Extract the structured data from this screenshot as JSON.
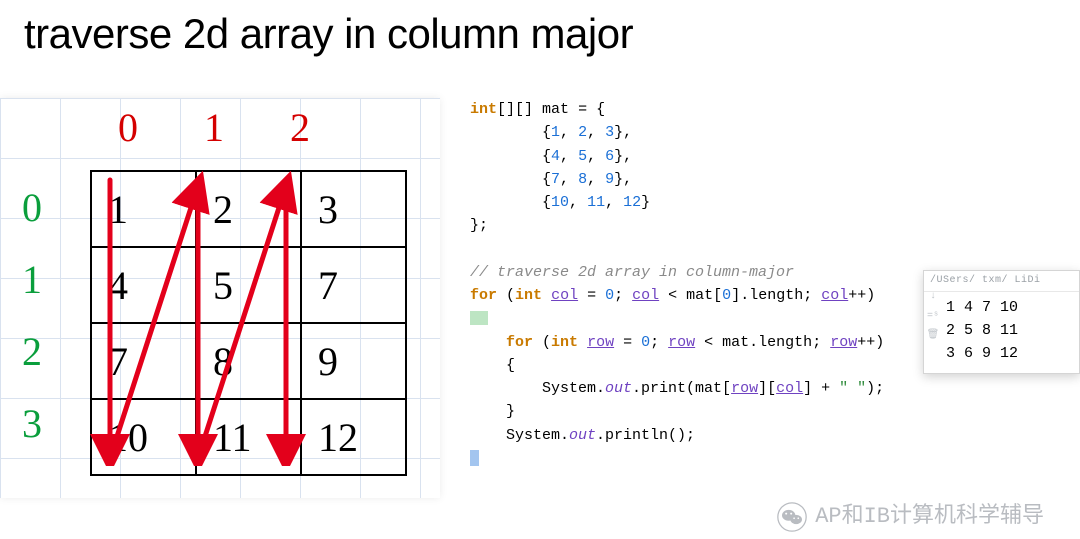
{
  "title": "traverse 2d array in column major",
  "diagram": {
    "col_labels": [
      "0",
      "1",
      "2"
    ],
    "row_labels": [
      "0",
      "1",
      "2",
      "3"
    ],
    "matrix": [
      [
        "1",
        "2",
        "3"
      ],
      [
        "4",
        "5",
        "7"
      ],
      [
        "7",
        "8",
        "9"
      ],
      [
        "10",
        "11",
        "12"
      ]
    ]
  },
  "code": {
    "decl_kw": "int",
    "decl_brackets": "[][]",
    "decl_var": "mat",
    "decl_eq": " = {",
    "rows": [
      "{1, 2, 3},",
      "{4, 5, 6},",
      "{7, 8, 9},",
      "{10, 11, 12}"
    ],
    "decl_close": "};",
    "comment": "// traverse 2d array in column-major",
    "for_outer_kw": "for",
    "for_outer_open": " (",
    "for_outer_int": "int",
    "for_outer_var": "col",
    "for_outer_init": " = ",
    "zero": "0",
    "semi": "; ",
    "lt": " < ",
    "mat0len": "mat[0].length",
    "matlen": "mat.length",
    "pp": "++",
    "for_inner_var": "row",
    "brace_open": "{",
    "brace_close": "}",
    "print_lead": "System.",
    "print_out": "out",
    "print_call": ".print(mat[",
    "print_mid": "][",
    "print_tail": "] + ",
    "print_space_str": "\" \"",
    "print_end": ");",
    "println_call": ".println();"
  },
  "output": {
    "header": "/USers/ txm/ LiDi",
    "lines": [
      "1 4 7 10",
      "2 5 8 11",
      "3 6 9 12"
    ],
    "gutter_icons": [
      "↓",
      "=ˢ",
      "🗑"
    ]
  },
  "watermark": {
    "icon_label": "wechat-icon",
    "text": "AP和IB计算机科学辅导"
  }
}
